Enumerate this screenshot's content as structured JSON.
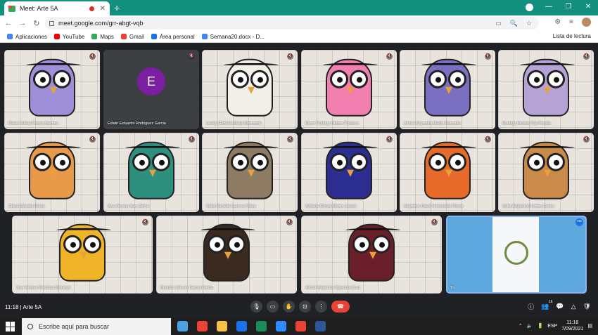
{
  "browser": {
    "tab_title": "Meet: Arte 5A",
    "tab_close": "✕",
    "new_tab": "+",
    "window_controls": [
      "—",
      "❐",
      "✕"
    ],
    "url": "meet.google.com/grr-abgt-vqb",
    "nav": [
      "←",
      "→",
      "↻"
    ],
    "omni_icons": [
      "▭",
      "🔍",
      "☆"
    ],
    "ext_icons": [
      "⚙",
      "≡"
    ]
  },
  "bookmarks": {
    "items": [
      {
        "label": "Aplicaciones",
        "color": "#4285f4"
      },
      {
        "label": "YouTube",
        "color": "#ff0000"
      },
      {
        "label": "Maps",
        "color": "#34a853"
      },
      {
        "label": "Gmail",
        "color": "#ea4335"
      },
      {
        "label": "Área personal",
        "color": "#1a73e8"
      },
      {
        "label": "Semana20.docx - D...",
        "color": "#4285f4"
      }
    ],
    "reading_list": "Lista de lectura"
  },
  "participants": [
    {
      "name": "Maria Valeria Franco Bachez",
      "owl": "#9f8fd8"
    },
    {
      "name": "Edwin Estuardo Rodriguez Garcia",
      "avatar": "E"
    },
    {
      "name": "Lessly Gabriela Mejia Marroquin",
      "owl": "#f2efe8"
    },
    {
      "name": "Elmer Rodrigo Oldson Polanco",
      "owl": "#f37fb0"
    },
    {
      "name": "Aimee Alejandra Martin Gonzalez",
      "owl": "#7b6fc2"
    },
    {
      "name": "Rodrigo Nicolas Paz Peralta",
      "owl": "#b5a3d6"
    },
    {
      "name": "Clara Gabriela Reina",
      "owl": "#e89a4a"
    },
    {
      "name": "Ana Ximena Iban Zetino",
      "owl": "#2f8f7f"
    },
    {
      "name": "Sofia Michelle Carreno Meza",
      "owl": "#8d7b64"
    },
    {
      "name": "Adriana Dinora Monzu Juarez",
      "owl": "#2b2d91"
    },
    {
      "name": "Alejandro David Hernandez Flores",
      "owl": "#e86a2a"
    },
    {
      "name": "Sofia Alejandra Roman Cortez",
      "owl": "#c98a4a"
    },
    {
      "name": "Jose Andres Mendoza Montoya",
      "owl": "#f0b429"
    },
    {
      "name": "Brandon Steven Garcia Garcia",
      "owl": "#3a2a1f"
    },
    {
      "name": "Althair Alejandra Siguenza Cruz",
      "owl": "#6b1f2a"
    },
    {
      "name": "Tú",
      "flag": true
    }
  ],
  "meeting": {
    "time": "11:18",
    "separator": "|",
    "name": "Arte 5A",
    "controls": [
      "🎙",
      "▭",
      "✋",
      "⊡",
      "⋮"
    ],
    "end": "☎",
    "right_icons": [
      "ⓘ",
      "👥",
      "💬",
      "△",
      "🛡"
    ],
    "people_count": "16"
  },
  "taskbar": {
    "search_placeholder": "Escribe aquí para buscar",
    "apps": [
      "#4aa3df",
      "#ea4335",
      "#f6c244",
      "#1a73e8",
      "#1c8d5a",
      "#2d8cff",
      "#ea4335",
      "#2b579a"
    ],
    "tray_icons": [
      "⌃",
      "🔈",
      "🔋"
    ],
    "lang": "ESP",
    "clock_time": "11:18",
    "clock_date": "7/09/2021",
    "notif": "▤"
  }
}
